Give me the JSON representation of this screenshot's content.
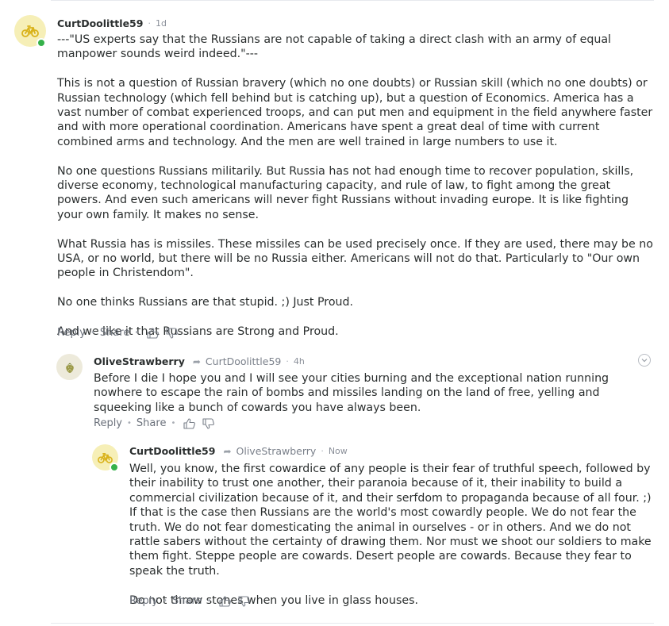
{
  "comments": [
    {
      "author": "CurtDoolittle59",
      "time": "1d",
      "paragraphs": [
        "---\"US experts say that the Russians are not capable of taking a direct clash with an army of equal manpower sounds weird indeed.\"---",
        "This is not a question of Russian bravery (which no one doubts) or Russian skill (which no one doubts) or Russian technology (which fell behind but is catching up), but a question of Economics.  America has a vast number of combat experienced troops, and can put men and equipment in the field anywhere faster and with more operational coordination.   Americans have spent a great deal of time with current combined arms and technology.  And the men are well trained in large numbers to use it.",
        "No one questions Russians militarily.  But Russia has not had enough time to recover population, skills, diverse economy, technological manufacturing capacity, and rule of law, to fight among the great powers.  And even such americans will never fight Russians without invading europe. It is like fighting your own family. It makes no sense.",
        "What Russia has is missiles.  These missiles can be used precisely once.  If they are used, there may be no USA, or no world, but there will be no Russia either.  Americans will not do that. Particularly to \"Our own people in Christendom\".",
        "No one thinks Russians are that stupid. ;)  Just Proud.",
        "And we like it that Russians are Strong and Proud."
      ],
      "actions": {
        "reply": "Reply",
        "share": "Share"
      }
    },
    {
      "author": "OliveStrawberry",
      "reply_to": "CurtDoolittle59",
      "time": "4h",
      "paragraphs": [
        "Before I die I hope you and I will see your cities burning and the exceptional nation running nowhere to escape the rain of bombs and missiles landing on the land of free, yelling and squeeking like a bunch of cowards you have always been."
      ],
      "actions": {
        "reply": "Reply",
        "share": "Share"
      }
    },
    {
      "author": "CurtDoolittle59",
      "reply_to": "OliveStrawberry",
      "time": "Now",
      "paragraphs": [
        "Well, you know, the first cowardice of any people is their fear of truthful speech, followed by their inability to trust one another, their paranoia because of it,  their inability to build a commercial civilization because of it, and their serfdom to propaganda because of all four. ;)   If that is the case then Russians are the world's most cowardly people.  We do not fear the truth.  We do not fear domesticating the animal in ourselves - or in others. And we do not rattle sabers without the certainty of drawing them. Nor must we shoot our soldiers to make them fight. Steppe people are cowards.  Desert people are cowards. Because they fear to speak the truth.",
        "Do not throw stones when you live in glass houses."
      ],
      "actions": {
        "reply": "Reply",
        "share": "Share"
      }
    }
  ],
  "icons": {
    "avatar_curt": "bicycle-icon",
    "avatar_olive": "strawberry-icon",
    "reply_arrow": "reply-arrow-icon",
    "upvote": "thumbs-up-icon",
    "downvote": "thumbs-down-icon",
    "collapse": "chevron-down-icon"
  },
  "colors": {
    "presence": "#35b14a",
    "curt_avatar_bg": "#f6efb7",
    "olive_avatar_bg": "#edeadb"
  }
}
